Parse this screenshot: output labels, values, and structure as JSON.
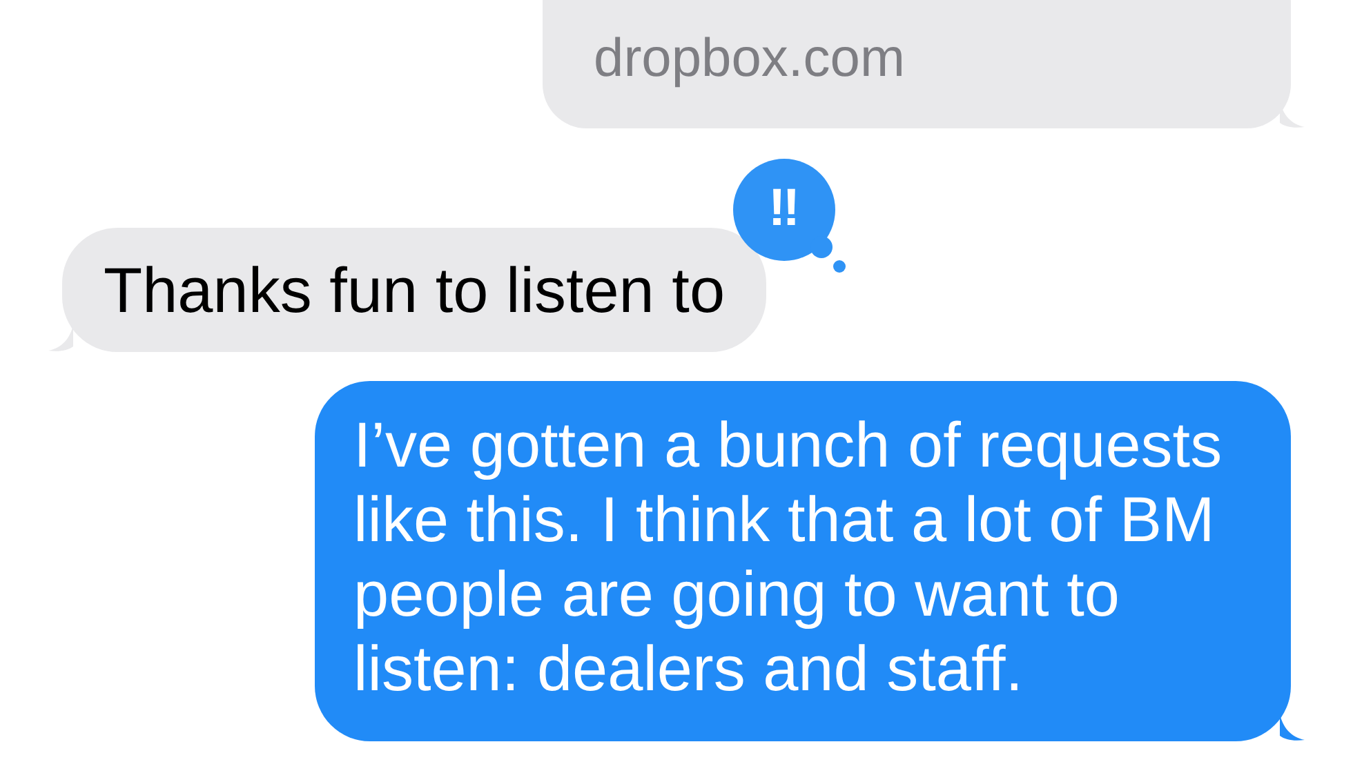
{
  "messages": [
    {
      "kind": "link_preview",
      "domain": "dropbox.com"
    },
    {
      "kind": "received",
      "text": "Thanks fun to listen to",
      "tapback": "‼"
    },
    {
      "kind": "sent",
      "text": "I’ve gotten a bunch of requests like this. I think that a lot of BM people are going to want to listen: dealers and staff."
    }
  ]
}
